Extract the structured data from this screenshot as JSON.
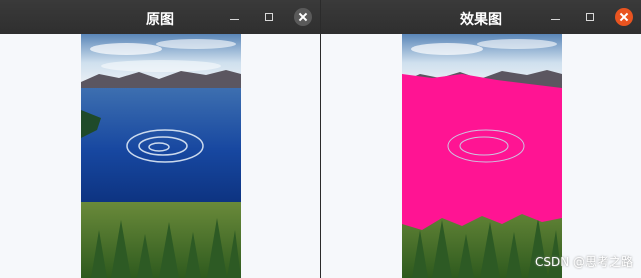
{
  "windows": [
    {
      "title": "原图"
    },
    {
      "title": "效果图"
    }
  ],
  "colors": {
    "titlebar": "#303030",
    "close_left": "#5a5a5a",
    "close_right": "#e95420",
    "client_bg": "#f6f8fb",
    "mask": "#ff1493"
  },
  "icons": {
    "minimize": "minimize-icon",
    "maximize": "maximize-icon",
    "close": "close-icon"
  },
  "watermark": "CSDN @思考之路"
}
